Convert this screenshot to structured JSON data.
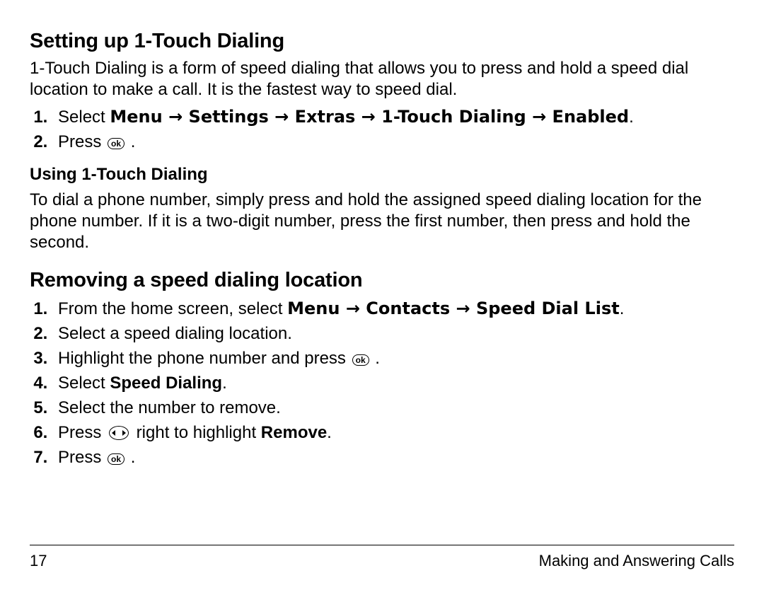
{
  "section1": {
    "heading": "Setting up 1-Touch Dialing",
    "intro": "1-Touch Dialing is a form of speed dialing that allows you to press and hold a speed dial location to make a call. It is the fastest way to speed dial.",
    "step1_prefix": "Select ",
    "step1_path": "Menu → Settings → Extras → 1-Touch Dialing → Enabled",
    "step1_suffix": ".",
    "step2_prefix": "Press ",
    "step2_suffix": " .",
    "sub_heading": "Using 1-Touch Dialing",
    "sub_body": "To dial a phone number, simply press and hold the assigned speed dialing location for the phone number. If it is a two-digit number, press the first number, then press and hold the second."
  },
  "section2": {
    "heading": "Removing a speed dialing location",
    "step1_prefix": "From the home screen, select ",
    "step1_path": "Menu → Contacts → Speed Dial List",
    "step1_suffix": ".",
    "step2": "Select a speed dialing location.",
    "step3_prefix": "Highlight the phone number and press ",
    "step3_suffix": " .",
    "step4_prefix": "Select ",
    "step4_bold": "Speed Dialing",
    "step4_suffix": ".",
    "step5": "Select the number to remove.",
    "step6_prefix": "Press ",
    "step6_mid": " right to highlight ",
    "step6_bold": "Remove",
    "step6_suffix": ".",
    "step7_prefix": "Press ",
    "step7_suffix": " ."
  },
  "icons": {
    "ok": "ok"
  },
  "footer": {
    "page": "17",
    "chapter": "Making and Answering Calls"
  }
}
